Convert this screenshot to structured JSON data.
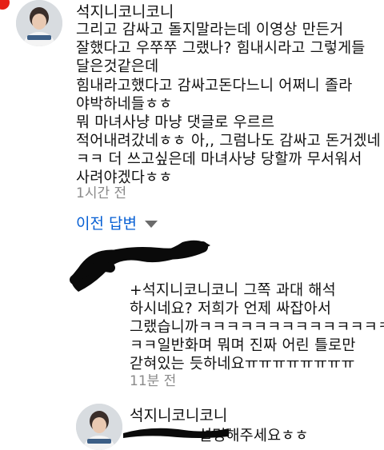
{
  "comment": {
    "author": "석지니코니코니",
    "lines": [
      "그리고 감싸고 돌지말라는데 이영상 만든거",
      "잘했다고 우쭈쭈 그랬나? 힘내시라고 그렇게들",
      "달은것같은데",
      "힘내라고했다고 감싸고돈다느니 어쩌니 졸라",
      "야박하네들ㅎㅎ",
      "뭐 마녀사냥 마냥  댓글로 우르르",
      "적어내려갔네ㅎㅎ 아,, 그럼나도 감싸고 돈거겠네",
      "ㅋㅋ  더 쓰고싶은데 마녀사냥 당할까 무서워서",
      "사려야겠다ㅎㅎ"
    ],
    "time": "1시간 전"
  },
  "previous_replies_label": "이전 답변",
  "reply": {
    "lines": [
      "+석지니코니코니 그쪽 과대 해석",
      "하시네요? 저희가 언제 싸잡아서",
      "그랬습니까ㅋㅋㅋㅋㅋㅋㅋㅋㅋㅋㅋㅋㅋㅋ",
      "ㅋㅋ일반화며 뭐며 진짜 어린 틀로만",
      "갇혀있는 듯하네요ㅠㅠㅠㅠㅠㅠㅠㅠ"
    ],
    "time": "11분 전"
  },
  "next_comment": {
    "author": "석지니코니코니",
    "partial_text": "설명해주세요ㅎㅎ"
  },
  "colors": {
    "link_blue": "#065fd4",
    "notification_red": "#e62117",
    "timestamp_gray": "#8a8a8a"
  }
}
